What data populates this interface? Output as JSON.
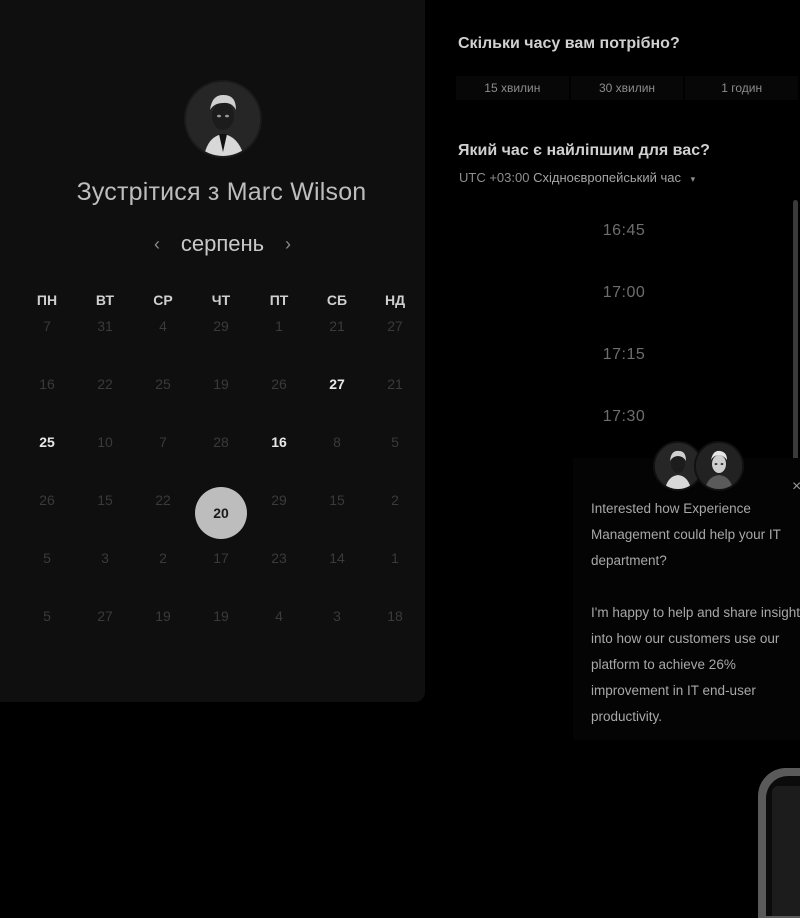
{
  "calendar": {
    "title": "Зустрітися з Marc Wilson",
    "month": "серпень",
    "prev_icon": "‹",
    "next_icon": "›",
    "weekdays": [
      "ПН",
      "ВТ",
      "СР",
      "ЧТ",
      "ПТ",
      "СБ",
      "НД"
    ],
    "days": [
      [
        "7",
        "31",
        "4",
        "29",
        "1",
        "21",
        "27"
      ],
      [
        "16",
        "22",
        "25",
        "19",
        "26",
        "27",
        "21"
      ],
      [
        "25",
        "10",
        "7",
        "28",
        "16",
        "8",
        "5"
      ],
      [
        "26",
        "15",
        "22",
        "20",
        "29",
        "15",
        "2"
      ],
      [
        "5",
        "3",
        "2",
        "17",
        "23",
        "14",
        "1"
      ],
      [
        "5",
        "27",
        "19",
        "19",
        "4",
        "3",
        "18"
      ]
    ],
    "available": [
      "1-5",
      "2-0",
      "2-4"
    ],
    "selected": "3-3"
  },
  "scheduler": {
    "duration_question": "Скільки часу вам потрібно?",
    "durations": [
      "15 хвилин",
      "30 хвилин",
      "1 годин"
    ],
    "time_question": "Який час є найліпшим для вас?",
    "timezone_offset": "UTC +03:00",
    "timezone_name": "Східноєвропейський час",
    "timezone_caret": "▾",
    "slots": [
      "16:45",
      "17:00",
      "17:15",
      "17:30"
    ]
  },
  "chat": {
    "close_icon": "×",
    "message_1": "Interested how Experience Management could help your IT department?",
    "message_2": "I'm happy to help and share insight into how our customers use our platform to achieve 26% improvement in IT end-user productivity."
  },
  "colors": {
    "background": "#000000",
    "panel": "#0f0f0f",
    "selected_day": "#bdbdbd"
  }
}
